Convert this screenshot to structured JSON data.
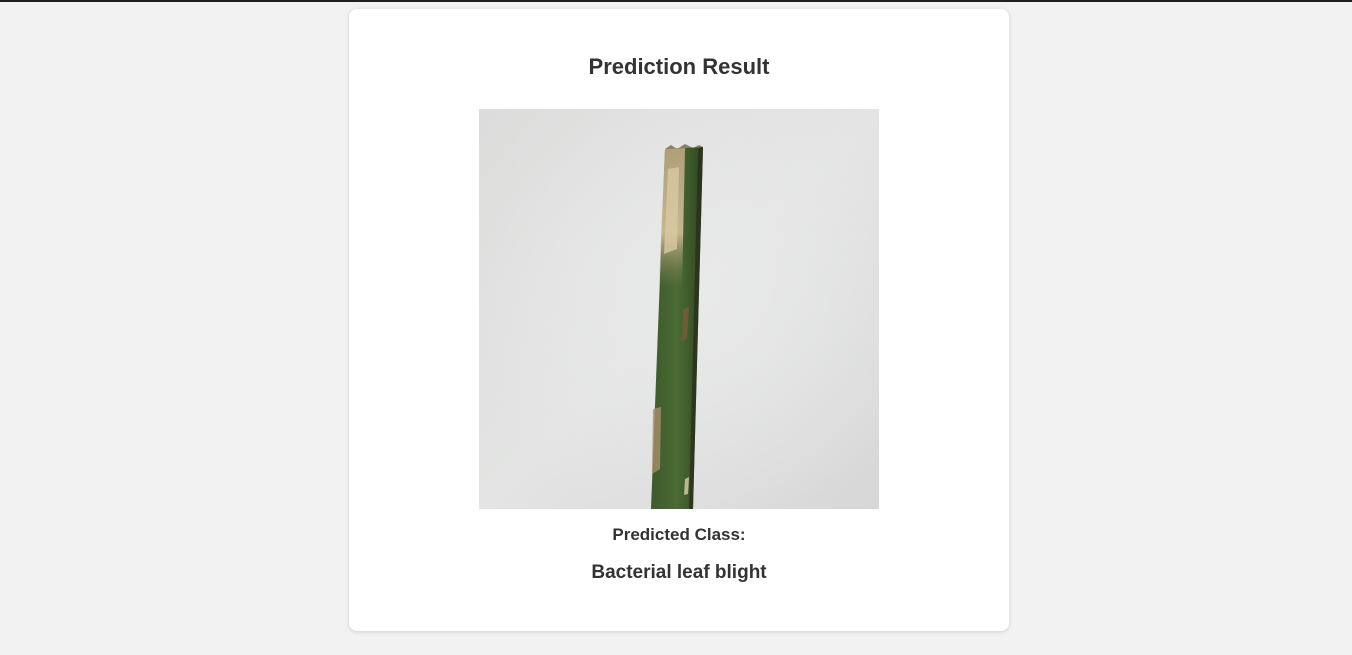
{
  "result": {
    "title": "Prediction Result",
    "predicted_label": "Predicted Class:",
    "predicted_value": "Bacterial leaf blight"
  },
  "colors": {
    "page_background": "#f2f2f2",
    "card_background": "#ffffff",
    "text": "#333333"
  }
}
